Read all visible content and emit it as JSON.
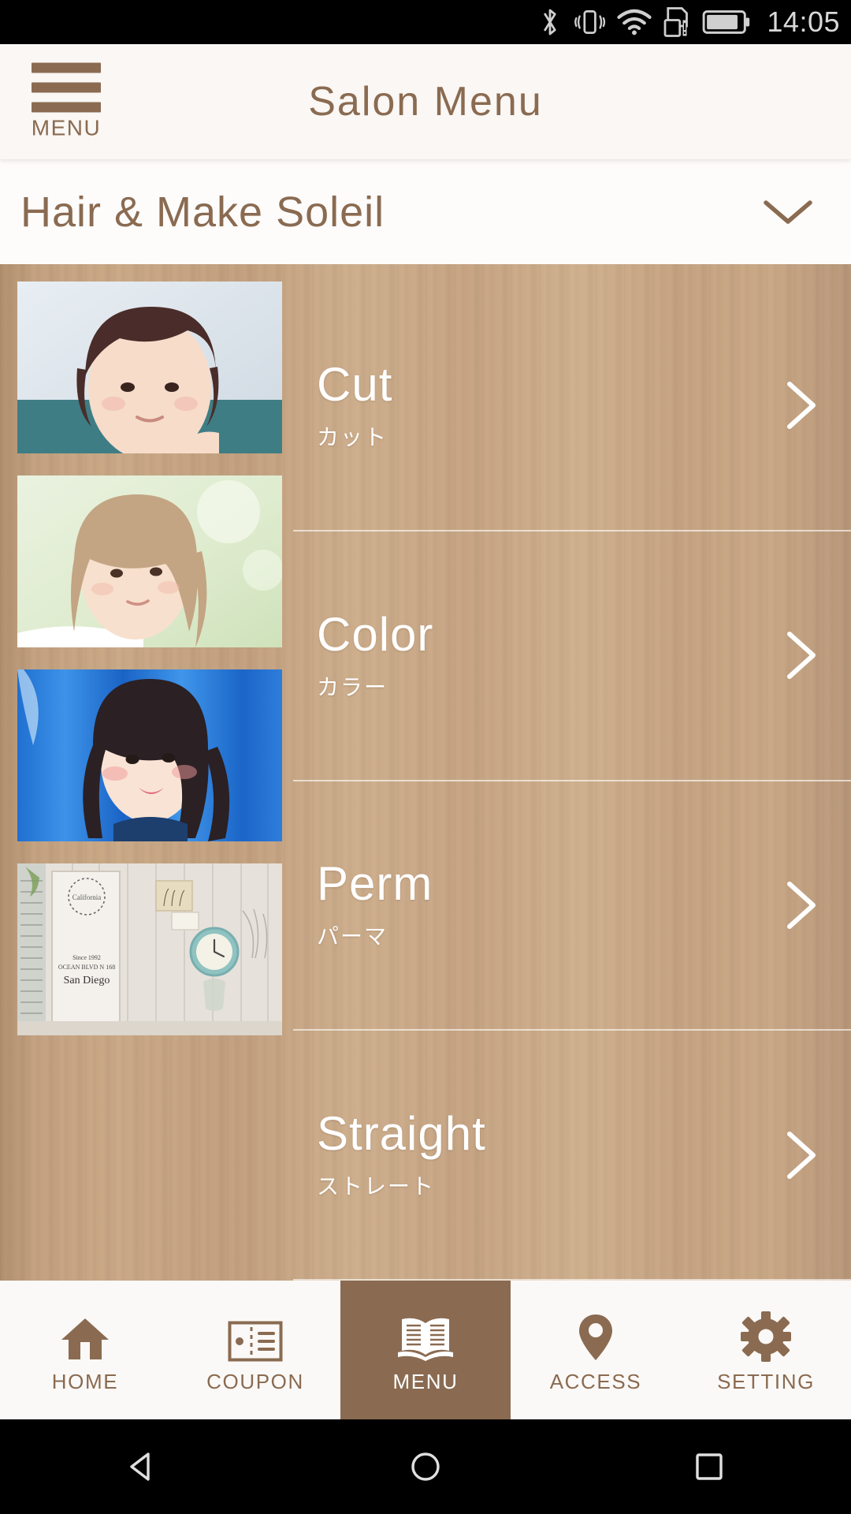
{
  "status_bar": {
    "time": "14:05",
    "icons": [
      "bluetooth-icon",
      "vibrate-icon",
      "wifi-icon",
      "sd-card-warning-icon",
      "battery-icon"
    ]
  },
  "header": {
    "menu_button_label": "MENU",
    "title": "Salon Menu"
  },
  "salon_selector": {
    "name": "Hair & Make Soleil",
    "expand_icon": "chevron-down-icon"
  },
  "menu_items": [
    {
      "en": "Cut",
      "jp": "カット",
      "thumb": "short-bob-portrait",
      "arrow": "chevron-right-icon"
    },
    {
      "en": "Color",
      "jp": "カラー",
      "thumb": "beige-hair-portrait",
      "arrow": "chevron-right-icon"
    },
    {
      "en": "Perm",
      "jp": "パーマ",
      "thumb": "wavy-hair-blue-backdrop",
      "arrow": "chevron-right-icon"
    },
    {
      "en": "Straight",
      "jp": "ストレート",
      "thumb": "salon-interior-decor",
      "arrow": "chevron-right-icon"
    }
  ],
  "bottom_nav": {
    "active": "MENU",
    "tabs": [
      {
        "label": "HOME",
        "icon": "home-icon"
      },
      {
        "label": "COUPON",
        "icon": "ticket-icon"
      },
      {
        "label": "MENU",
        "icon": "open-book-icon"
      },
      {
        "label": "ACCESS",
        "icon": "map-pin-icon"
      },
      {
        "label": "SETTING",
        "icon": "gear-icon"
      }
    ]
  },
  "android_nav": {
    "buttons": [
      "back-triangle-icon",
      "home-circle-icon",
      "recents-square-icon"
    ]
  },
  "colors": {
    "brand_brown": "#8a6b51",
    "header_bg": "#faf7f4",
    "wood_bg": "#c6a483",
    "nav_bg": "#fbf9f7"
  }
}
